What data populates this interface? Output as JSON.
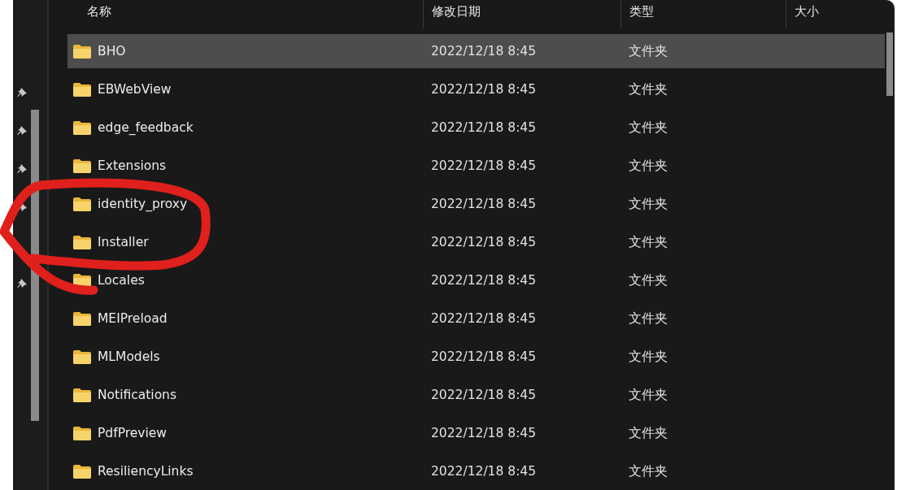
{
  "columns": [
    "名称",
    "修改日期",
    "类型",
    "大小"
  ],
  "rows": [
    {
      "name": "BHO",
      "modified": "2022/12/18 8:45",
      "type": "文件夹",
      "selected": true
    },
    {
      "name": "EBWebView",
      "modified": "2022/12/18 8:45",
      "type": "文件夹",
      "selected": false
    },
    {
      "name": "edge_feedback",
      "modified": "2022/12/18 8:45",
      "type": "文件夹",
      "selected": false
    },
    {
      "name": "Extensions",
      "modified": "2022/12/18 8:45",
      "type": "文件夹",
      "selected": false
    },
    {
      "name": "identity_proxy",
      "modified": "2022/12/18 8:45",
      "type": "文件夹",
      "selected": false
    },
    {
      "name": "Installer",
      "modified": "2022/12/18 8:45",
      "type": "文件夹",
      "selected": false
    },
    {
      "name": "Locales",
      "modified": "2022/12/18 8:45",
      "type": "文件夹",
      "selected": false
    },
    {
      "name": "MEIPreload",
      "modified": "2022/12/18 8:45",
      "type": "文件夹",
      "selected": false
    },
    {
      "name": "MLModels",
      "modified": "2022/12/18 8:45",
      "type": "文件夹",
      "selected": false
    },
    {
      "name": "Notifications",
      "modified": "2022/12/18 8:45",
      "type": "文件夹",
      "selected": false
    },
    {
      "name": "PdfPreview",
      "modified": "2022/12/18 8:45",
      "type": "文件夹",
      "selected": false
    },
    {
      "name": "ResiliencyLinks",
      "modified": "2022/12/18 8:45",
      "type": "文件夹",
      "selected": false
    }
  ]
}
